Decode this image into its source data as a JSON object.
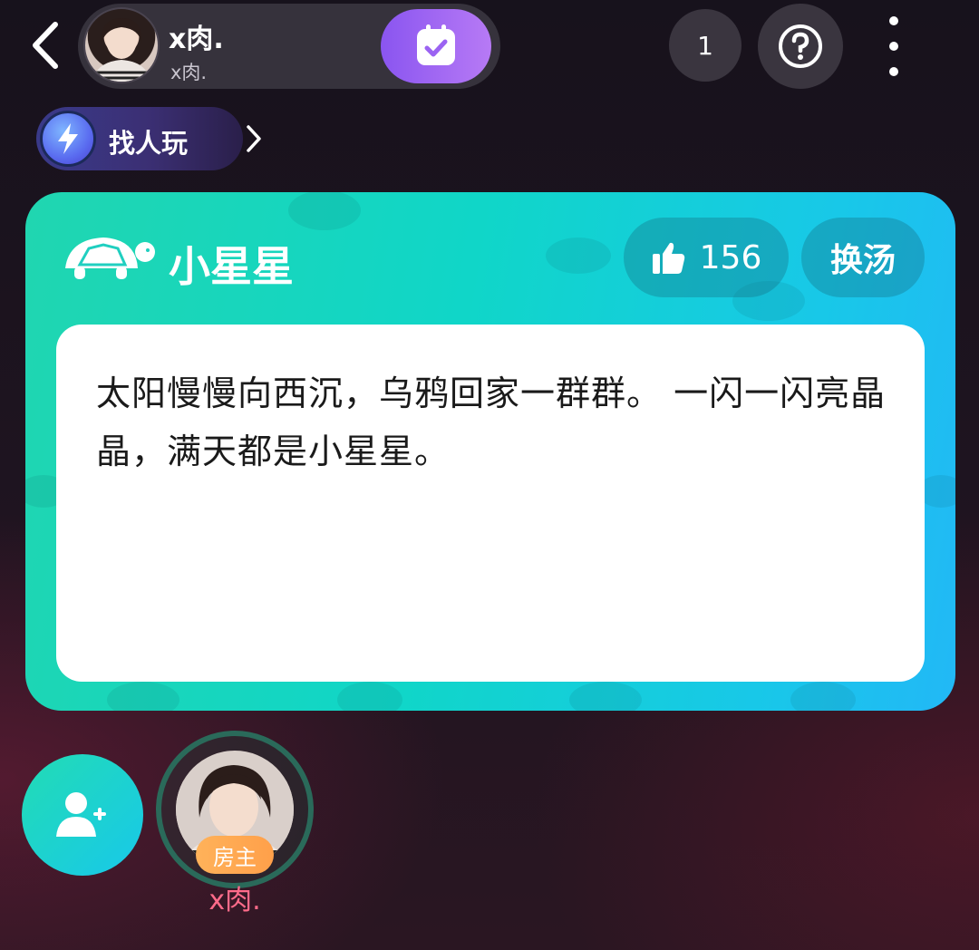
{
  "header": {
    "room_title": "x肉.",
    "room_subtitle": "x肉.",
    "online_count": "1",
    "icons": {
      "back": "chevron-left-icon",
      "checkin": "calendar-check-icon",
      "help": "question-icon",
      "more": "more-vertical-icon"
    }
  },
  "find_people": {
    "label": "找人玩",
    "icon": "lightning-icon"
  },
  "game": {
    "title": "小星星",
    "likes": "156",
    "switch_label": "换汤",
    "soup_text": "太阳慢慢向西沉，乌鸦回家一群群。 一闪一闪亮晶晶，满天都是小星星。",
    "icons": {
      "logo": "turtle-icon",
      "like": "thumbs-up-icon"
    },
    "colors": {
      "card_start": "#20d6b0",
      "card_end": "#22b8f6"
    }
  },
  "seats": {
    "invite_icon": "add-user-icon",
    "host": {
      "name": "x肉.",
      "badge": "房主"
    }
  },
  "colors": {
    "background": "#1f1420",
    "accent_purple": "#8a55f0",
    "host_name": "#ff6b8a",
    "owner_badge": "#ffa04a"
  }
}
